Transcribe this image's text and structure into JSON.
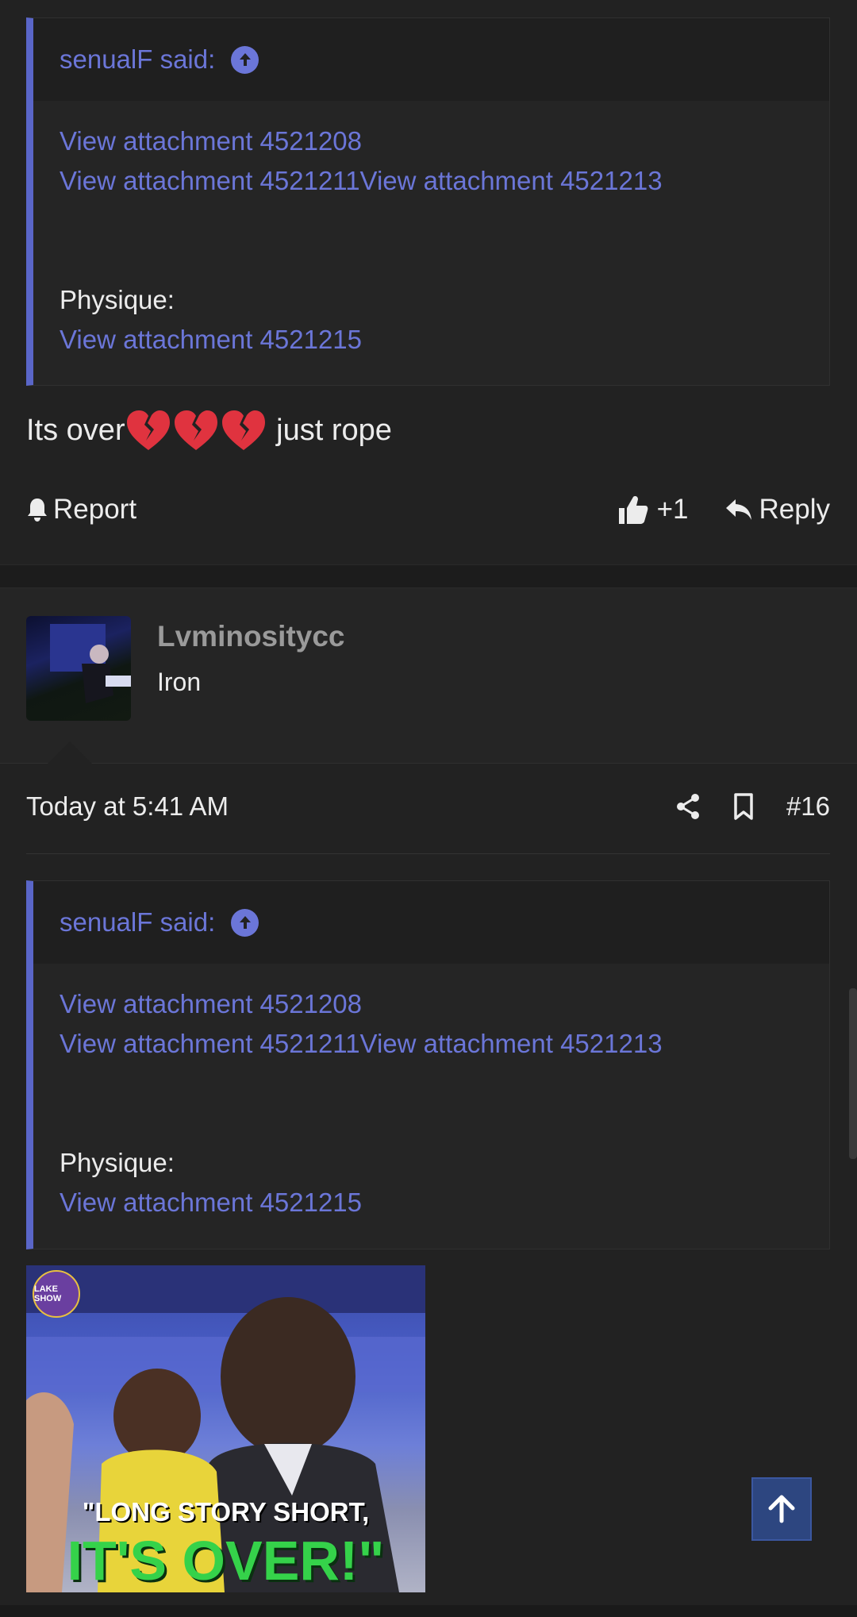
{
  "post1": {
    "quote": {
      "author_line": "senualF said:",
      "attachments_row1": "View attachment 4521208",
      "attachments_row2": "View attachment 4521211View attachment 4521213",
      "physique_label": "Physique:",
      "attachment_physique": "View attachment 4521215"
    },
    "message_before": "Its over",
    "message_after": " just rope",
    "actions": {
      "report": "Report",
      "like_count": "+1",
      "reply": "Reply"
    }
  },
  "post2": {
    "user": {
      "name": "Lvminositycc",
      "title": "Iron"
    },
    "timestamp": "Today at 5:41 AM",
    "post_number": "#16",
    "quote": {
      "author_line": "senualF said:",
      "attachments_row1": "View attachment 4521208",
      "attachments_row2": "View attachment 4521211View attachment 4521213",
      "physique_label": "Physique:",
      "attachment_physique": "View attachment 4521215"
    },
    "image": {
      "badge_text": "LAKE SHOW",
      "caption_line1": "\"LONG STORY SHORT,",
      "caption_line2": "IT'S OVER!\""
    }
  },
  "icons": {
    "quote_jump": "arrow-up-circle-icon",
    "heart": "broken-heart-icon",
    "report": "bell-icon",
    "like": "thumbs-up-icon",
    "reply": "reply-icon",
    "share": "share-icon",
    "bookmark": "bookmark-icon",
    "back_to_top": "arrow-up-icon"
  },
  "colors": {
    "background": "#222222",
    "accent": "#6b76d8",
    "quote_border": "#5a66c8",
    "back_to_top": "#2d4680"
  }
}
